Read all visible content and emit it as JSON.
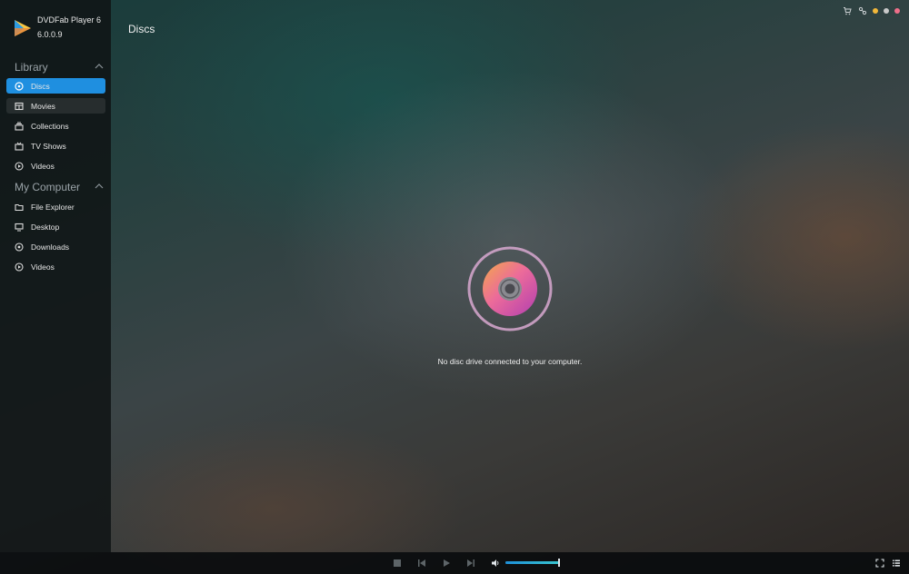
{
  "app": {
    "name": "DVDFab Player 6",
    "version": "6.0.0.9"
  },
  "sidebar": {
    "library": {
      "label": "Library",
      "items": [
        {
          "label": "Discs",
          "icon": "disc-icon",
          "active": true
        },
        {
          "label": "Movies",
          "icon": "movie-icon"
        },
        {
          "label": "Collections",
          "icon": "collections-icon"
        },
        {
          "label": "TV Shows",
          "icon": "tv-icon"
        },
        {
          "label": "Videos",
          "icon": "video-icon"
        }
      ]
    },
    "computer": {
      "label": "My Computer",
      "items": [
        {
          "label": "File Explorer",
          "icon": "folder-icon"
        },
        {
          "label": "Desktop",
          "icon": "desktop-icon"
        },
        {
          "label": "Downloads",
          "icon": "download-icon"
        },
        {
          "label": "Videos",
          "icon": "video-icon"
        }
      ]
    }
  },
  "main": {
    "title": "Discs",
    "empty_message": "No disc drive connected to your computer."
  },
  "player": {
    "volume": 0.98
  },
  "colors": {
    "accent": "#1f8fe0",
    "disc_pink": "#d84fa4",
    "disc_orange": "#f09a4a"
  }
}
